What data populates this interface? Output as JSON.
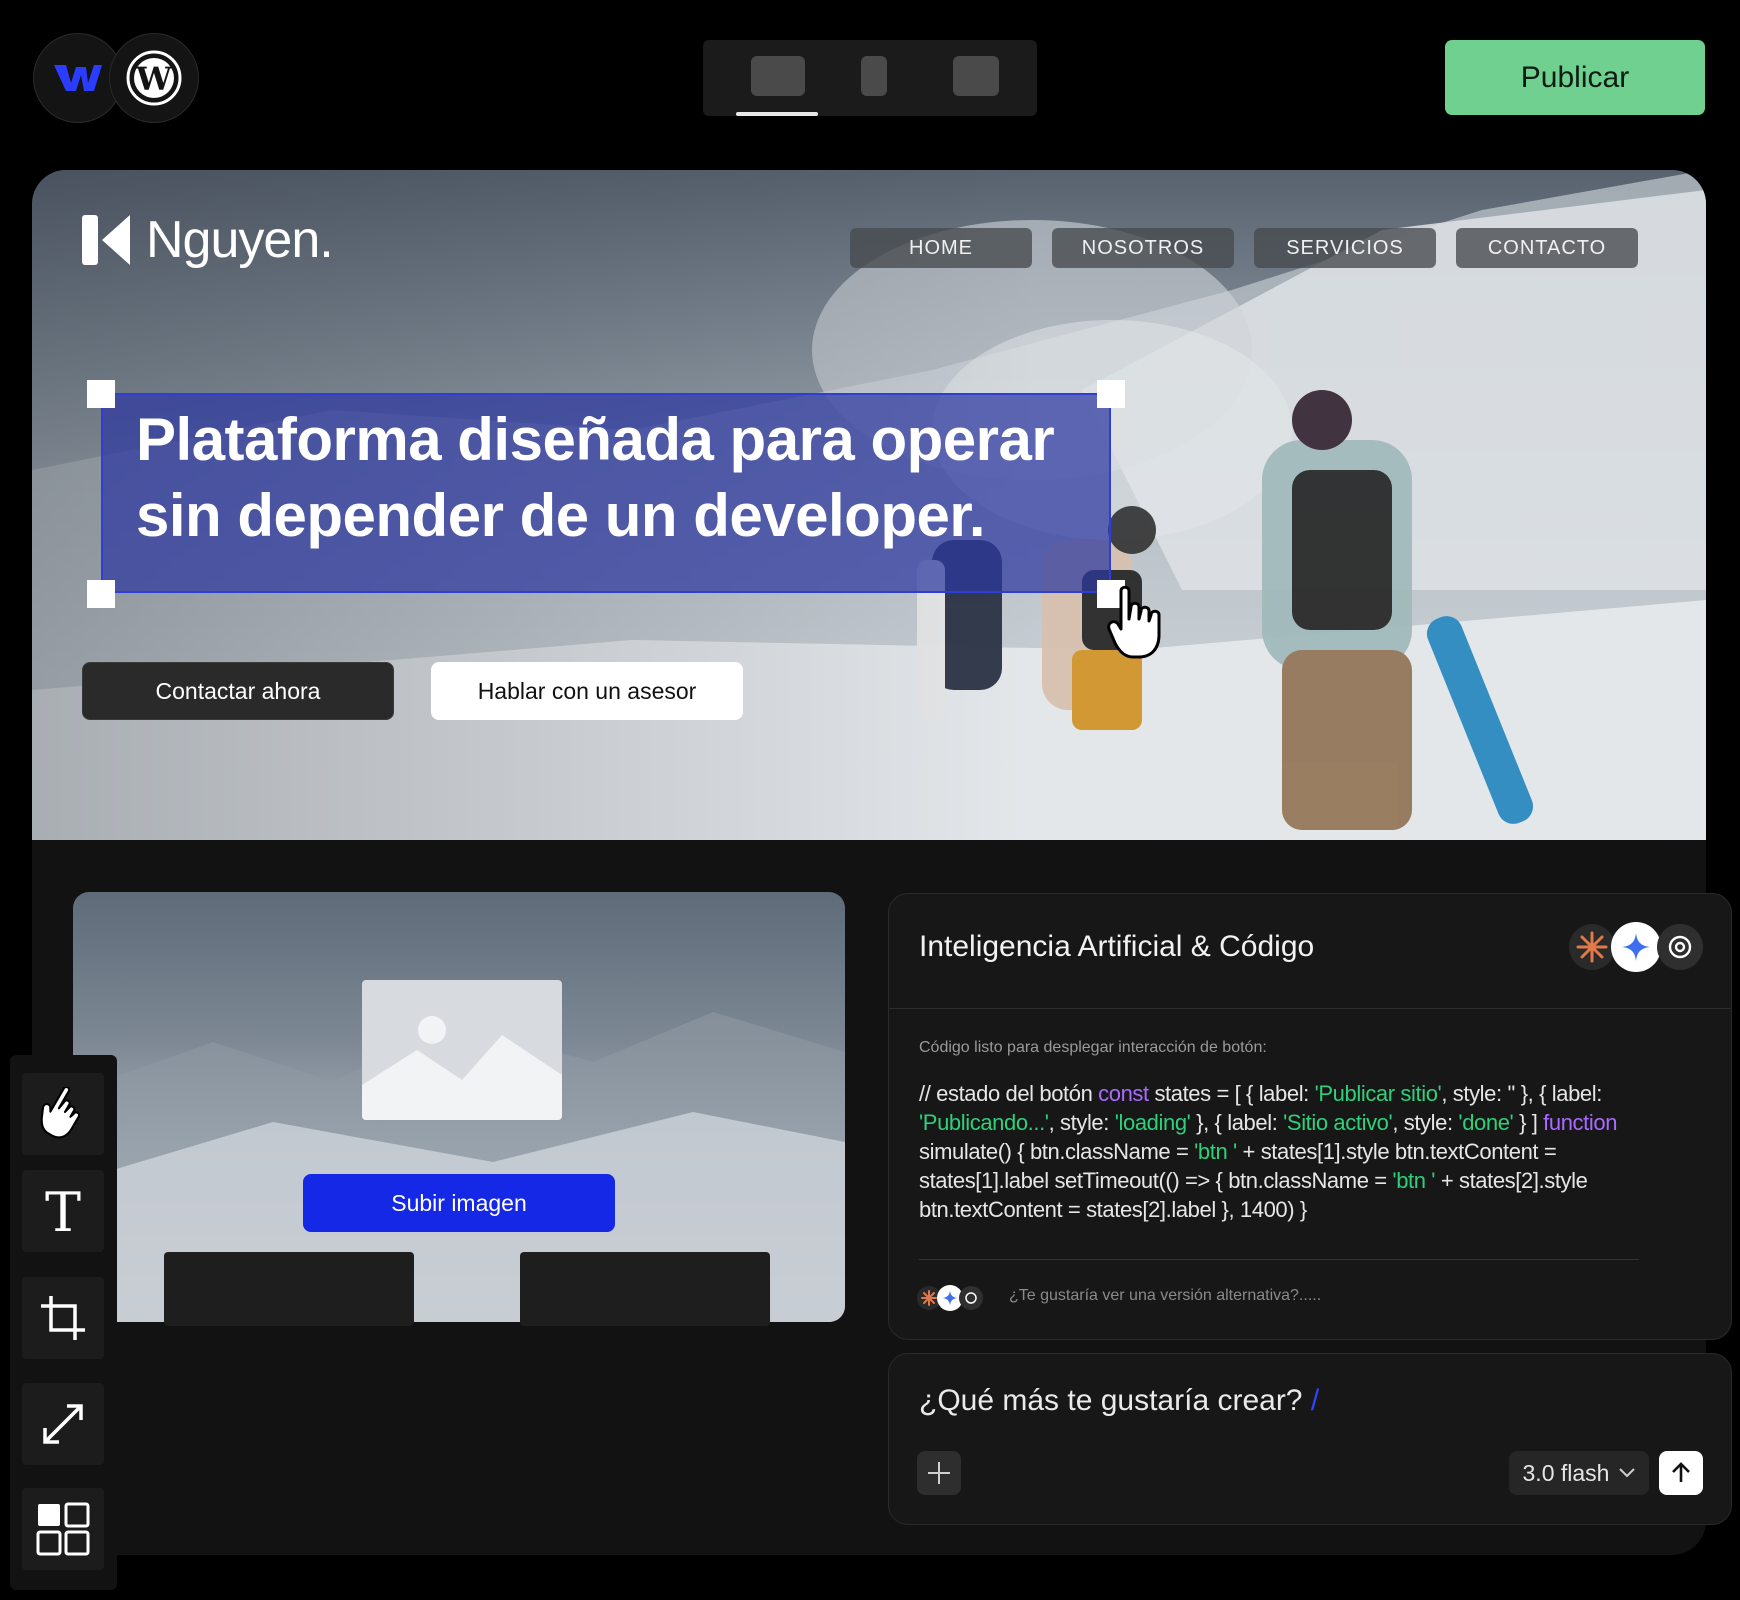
{
  "toolbar": {
    "logos": [
      "webflow-logo",
      "wordpress-logo"
    ],
    "devices": [
      "desktop",
      "tablet",
      "mobile"
    ],
    "publish_label": "Publicar"
  },
  "site": {
    "brand": "Nguyen.",
    "nav": [
      "HOME",
      "NOSOTROS",
      "SERVICIOS",
      "CONTACTO"
    ],
    "headline_line1": "Plataforma diseñada para operar",
    "headline_line2": "sin depender de un developer.",
    "cta_primary": "Contactar ahora",
    "cta_secondary": "Hablar con un asesor"
  },
  "image_card": {
    "upload_label": "Subir imagen"
  },
  "ai_panel": {
    "title": "Inteligencia Artificial & Código",
    "subtitle": "Código listo para desplegar interacción de botón:",
    "code_tokens": [
      {
        "t": "// estado del botón ",
        "c": "txt"
      },
      {
        "t": "const",
        "c": "kw"
      },
      {
        "t": " states = [ { label: ",
        "c": "txt"
      },
      {
        "t": "'Publicar sitio'",
        "c": "str"
      },
      {
        "t": ", style: '' }, { label: ",
        "c": "txt"
      },
      {
        "t": "'Publicando...'",
        "c": "str"
      },
      {
        "t": ", style: ",
        "c": "txt"
      },
      {
        "t": "'loading'",
        "c": "str"
      },
      {
        "t": " }, { label: ",
        "c": "txt"
      },
      {
        "t": "'Sitio activo'",
        "c": "str"
      },
      {
        "t": ", style: ",
        "c": "txt"
      },
      {
        "t": "'done'",
        "c": "str"
      },
      {
        "t": " } ] ",
        "c": "txt"
      },
      {
        "t": "function",
        "c": "kw"
      },
      {
        "t": " simulate() { btn.className = ",
        "c": "txt"
      },
      {
        "t": "'btn '",
        "c": "str"
      },
      {
        "t": " + states[1].style btn.textContent = states[1].label setTimeout(() => { btn.className = ",
        "c": "txt"
      },
      {
        "t": "'btn '",
        "c": "str"
      },
      {
        "t": " + states[2].style btn.textContent = states[2].label }, 1400) }",
        "c": "txt"
      }
    ],
    "hint": "¿Te gustaría ver una versión alternativa?.....",
    "models": [
      "claude-icon",
      "gemini-icon",
      "openai-icon"
    ]
  },
  "prompt": {
    "question": "¿Qué más te gustaría crear?",
    "caret": "/",
    "model": "3.0 flash"
  },
  "tools": [
    "hand-pointer-icon",
    "text-icon",
    "crop-icon",
    "resize-icon",
    "grid-icon"
  ],
  "colors": {
    "accent_green": "#6fd08f",
    "accent_blue": "#1428e6",
    "selection_blue": "#2f3fd6",
    "code_keyword": "#a96bff",
    "code_string": "#2fd07a"
  }
}
